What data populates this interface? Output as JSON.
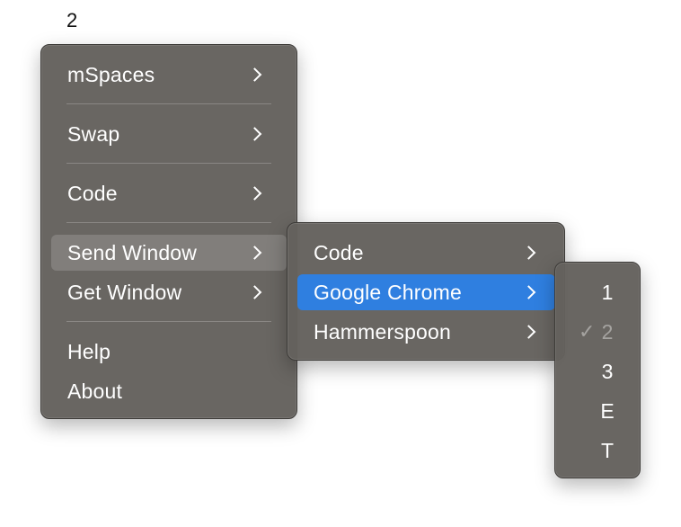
{
  "menubar": {
    "title": "2"
  },
  "main_menu": {
    "items": [
      {
        "label": "mSpaces"
      },
      {
        "label": "Swap"
      },
      {
        "label": "Code"
      },
      {
        "label": "Send Window"
      },
      {
        "label": "Get Window"
      },
      {
        "label": "Help"
      },
      {
        "label": "About"
      }
    ]
  },
  "send_window_menu": {
    "items": [
      {
        "label": "Code"
      },
      {
        "label": "Google Chrome"
      },
      {
        "label": "Hammerspoon"
      }
    ]
  },
  "space_menu": {
    "items": [
      {
        "label": "1",
        "checked": false,
        "enabled": true
      },
      {
        "label": "2",
        "checked": true,
        "enabled": false
      },
      {
        "label": "3",
        "checked": false,
        "enabled": true
      },
      {
        "label": "E",
        "checked": false,
        "enabled": true
      },
      {
        "label": "T",
        "checked": false,
        "enabled": true
      }
    ],
    "check_glyph": "✓"
  },
  "colors": {
    "menu_bg": "#64615d",
    "selection": "#2f7fe0"
  },
  "icons": {
    "submenu_arrow": "chevron-right-icon",
    "checkmark": "checkmark-icon"
  }
}
